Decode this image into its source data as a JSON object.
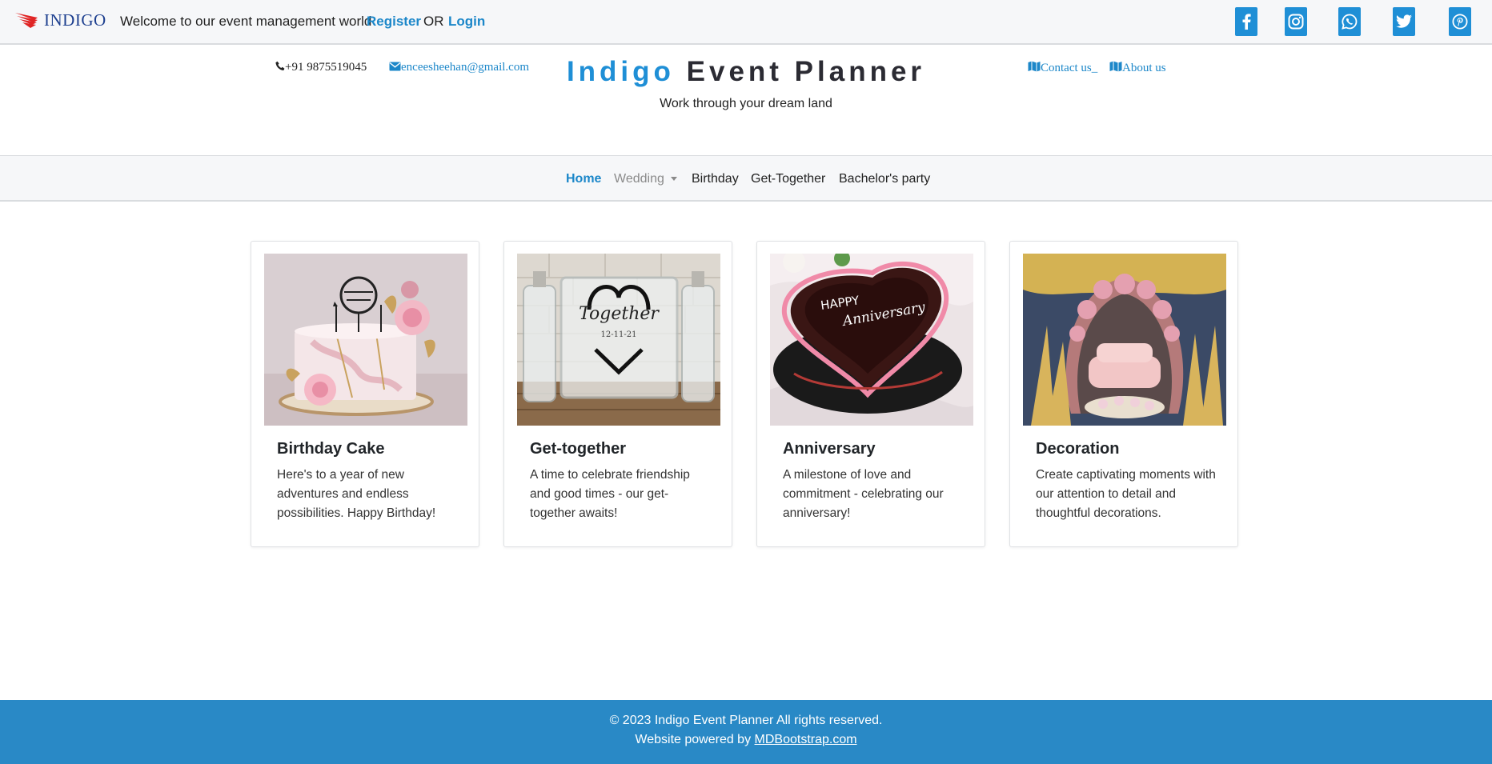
{
  "topbar": {
    "brand": "INDIGO",
    "welcome": "Welcome to our event management world",
    "register": "Register",
    "or": "OR",
    "login": "Login",
    "social_icons": [
      "facebook-icon",
      "instagram-icon",
      "whatsapp-icon",
      "twitter-icon",
      "pinterest-icon"
    ]
  },
  "header": {
    "phone": "+91 9875519045",
    "email": "enceesheehan@gmail.com",
    "title_part1": "Indigo",
    "title_part2": "Event Planner",
    "tagline": "Work through your dream land",
    "contact_us": "Contact us_",
    "about_us": "About us"
  },
  "nav": {
    "items": [
      "Home",
      "Wedding",
      "Birthday",
      "Get-Together",
      "Bachelor's party"
    ],
    "active": "Home"
  },
  "cards": [
    {
      "title": "Birthday Cake",
      "text": "Here's to a year of new adventures and endless possibilities. Happy Birthday!"
    },
    {
      "title": "Get-together",
      "text": "A time to celebrate friendship and good times - our get-together awaits!"
    },
    {
      "title": "Anniversary",
      "text": "A milestone of love and commitment - celebrating our anniversary!"
    },
    {
      "title": "Decoration",
      "text": "Create captivating moments with our attention to detail and thoughtful decorations."
    }
  ],
  "footer": {
    "copyright": "© 2023 Indigo Event Planner All rights reserved.",
    "powered_prefix": "Website powered by ",
    "powered_link": "MDBootstrap.com"
  },
  "colors": {
    "accent": "#1f8fd6",
    "link": "#1c87c9",
    "footer_bg": "#2989c6",
    "bar_bg": "#f6f7f9"
  }
}
